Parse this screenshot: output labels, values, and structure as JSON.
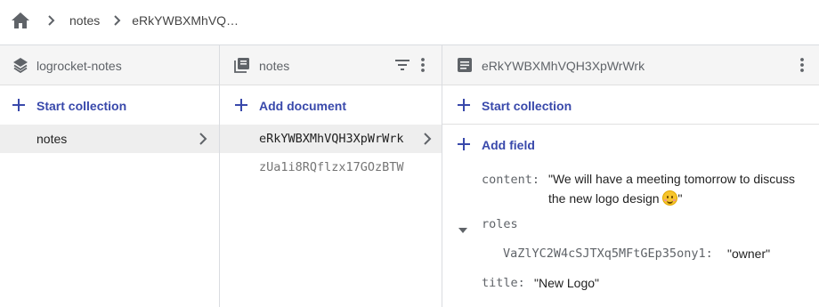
{
  "breadcrumb": {
    "items": [
      "notes",
      "eRkYWBXMhVQ…"
    ]
  },
  "panel_collections": {
    "title": "logrocket-notes",
    "action_label": "Start collection",
    "items": [
      {
        "label": "notes",
        "selected": true
      }
    ]
  },
  "panel_documents": {
    "title": "notes",
    "action_label": "Add document",
    "items": [
      {
        "label": "eRkYWBXMhVQH3XpWrWrk",
        "selected": true
      },
      {
        "label": "zUa1i8RQflzx17GOzBTW",
        "selected": false
      }
    ]
  },
  "panel_document": {
    "title": "eRkYWBXMhVQH3XpWrWrk",
    "start_collection_label": "Start collection",
    "add_field_label": "Add field",
    "fields": {
      "content_key": "content:",
      "content_line1": "\"We will have a meeting tomorrow to discuss",
      "content_line2": "the new logo design ",
      "content_line2_end": "\"",
      "roles_key": "roles",
      "roles_child_key": "VaZlYC2W4cSJTXq5MFtGEp35ony1:",
      "roles_child_value": "\"owner\"",
      "title_key": "title:",
      "title_value": "\"New Logo\""
    }
  },
  "colors": {
    "accent": "#3949ab",
    "header_bg": "#f5f5f5",
    "selected_bg": "#eeeeee",
    "border": "#dadce0"
  },
  "icons": {
    "home": "home-icon",
    "breadcrumb_sep": "chevron-right-icon",
    "collections": "layers-icon",
    "documents": "library-icon",
    "document": "document-icon",
    "filter": "filter-icon",
    "more": "more-vert-icon",
    "add": "plus-icon",
    "expand": "arrow-drop-down-icon",
    "emoji": "smiling-face-icon"
  }
}
